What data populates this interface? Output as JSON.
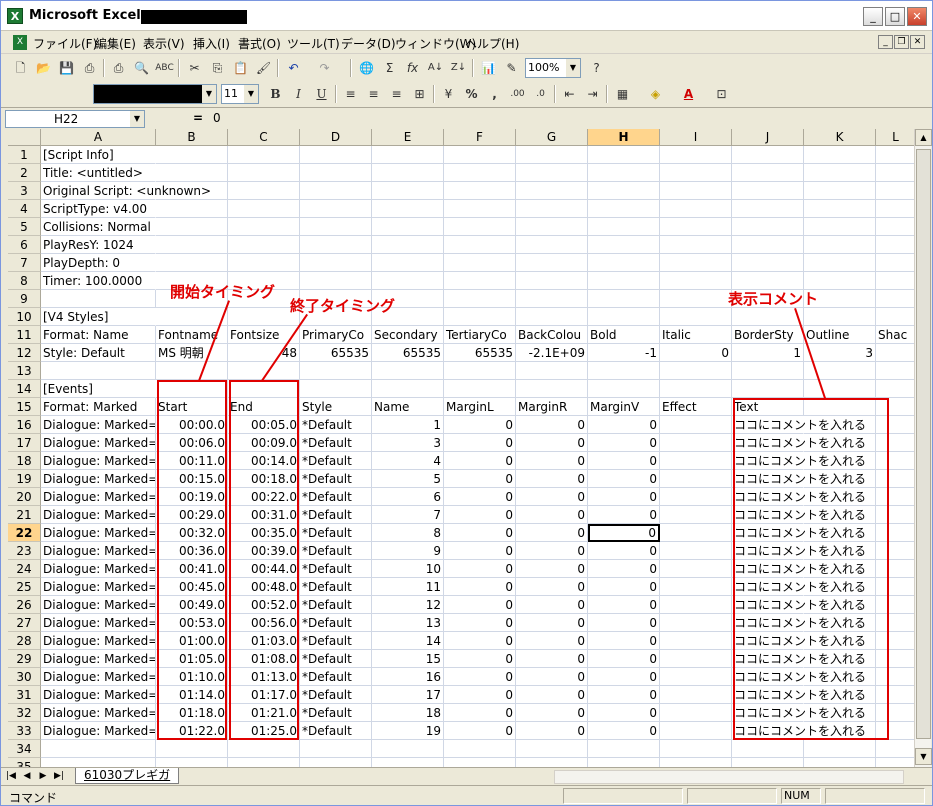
{
  "window": {
    "title": "Microsoft Excel -",
    "app_icon": "X"
  },
  "menu": {
    "doc_icon": "X",
    "items": [
      "ファイル(F)",
      "編集(E)",
      "表示(V)",
      "挿入(I)",
      "書式(O)",
      "ツール(T)",
      "データ(D)",
      "ウィンドウ(W)",
      "ヘルプ(H)"
    ]
  },
  "toolbar": {
    "zoom": "100%",
    "font_size": "11",
    "bold": "B",
    "italic": "I",
    "underline": "U",
    "percent": "%",
    "comma": ","
  },
  "formula": {
    "cell_ref": "H22",
    "eq": "=",
    "value": "0"
  },
  "columns": [
    "A",
    "B",
    "C",
    "D",
    "E",
    "F",
    "G",
    "H",
    "I",
    "J",
    "K",
    "L"
  ],
  "rows": [
    {
      "n": "1",
      "cells": [
        "[Script Info]"
      ]
    },
    {
      "n": "2",
      "cells": [
        "Title: <untitled>"
      ]
    },
    {
      "n": "3",
      "cells": [
        "Original Script: <unknown>"
      ]
    },
    {
      "n": "4",
      "cells": [
        "ScriptType: v4.00"
      ]
    },
    {
      "n": "5",
      "cells": [
        "Collisions: Normal"
      ]
    },
    {
      "n": "6",
      "cells": [
        "PlayResY: 1024"
      ]
    },
    {
      "n": "7",
      "cells": [
        "PlayDepth: 0"
      ]
    },
    {
      "n": "8",
      "cells": [
        "Timer: 100.0000"
      ]
    },
    {
      "n": "9",
      "cells": []
    },
    {
      "n": "10",
      "cells": [
        "[V4 Styles]"
      ]
    },
    {
      "n": "11",
      "cells": [
        "Format: Name",
        "Fontname",
        "Fontsize",
        "PrimaryCo",
        "Secondary",
        "TertiaryCo",
        "BackColou",
        "Bold",
        "Italic",
        "BorderSty",
        "Outline",
        "Shac"
      ]
    },
    {
      "n": "12",
      "cells": [
        "Style: Default",
        "MS 明朝",
        "48",
        "65535",
        "65535",
        "65535",
        "-2.1E+09",
        "-1",
        "0",
        "1",
        "3",
        ""
      ]
    },
    {
      "n": "13",
      "cells": []
    },
    {
      "n": "14",
      "cells": [
        "[Events]"
      ]
    },
    {
      "n": "15",
      "cells": [
        "Format: Marked",
        "Start",
        "End",
        "Style",
        "Name",
        "MarginL",
        "MarginR",
        "MarginV",
        "Effect",
        "Text"
      ]
    },
    {
      "n": "16",
      "cells": [
        "Dialogue: Marked=",
        "00:00.0",
        "00:05.0",
        "*Default",
        "1",
        "0",
        "0",
        "0",
        "",
        "ココにコメントを入れる"
      ]
    },
    {
      "n": "17",
      "cells": [
        "Dialogue: Marked=",
        "00:06.0",
        "00:09.0",
        "*Default",
        "3",
        "0",
        "0",
        "0",
        "",
        "ココにコメントを入れる"
      ]
    },
    {
      "n": "18",
      "cells": [
        "Dialogue: Marked=",
        "00:11.0",
        "00:14.0",
        "*Default",
        "4",
        "0",
        "0",
        "0",
        "",
        "ココにコメントを入れる"
      ]
    },
    {
      "n": "19",
      "cells": [
        "Dialogue: Marked=",
        "00:15.0",
        "00:18.0",
        "*Default",
        "5",
        "0",
        "0",
        "0",
        "",
        "ココにコメントを入れる"
      ]
    },
    {
      "n": "20",
      "cells": [
        "Dialogue: Marked=",
        "00:19.0",
        "00:22.0",
        "*Default",
        "6",
        "0",
        "0",
        "0",
        "",
        "ココにコメントを入れる"
      ]
    },
    {
      "n": "21",
      "cells": [
        "Dialogue: Marked=",
        "00:29.0",
        "00:31.0",
        "*Default",
        "7",
        "0",
        "0",
        "0",
        "",
        "ココにコメントを入れる"
      ]
    },
    {
      "n": "22",
      "cells": [
        "Dialogue: Marked=",
        "00:32.0",
        "00:35.0",
        "*Default",
        "8",
        "0",
        "0",
        "0",
        "",
        "ココにコメントを入れる"
      ]
    },
    {
      "n": "23",
      "cells": [
        "Dialogue: Marked=",
        "00:36.0",
        "00:39.0",
        "*Default",
        "9",
        "0",
        "0",
        "0",
        "",
        "ココにコメントを入れる"
      ]
    },
    {
      "n": "24",
      "cells": [
        "Dialogue: Marked=",
        "00:41.0",
        "00:44.0",
        "*Default",
        "10",
        "0",
        "0",
        "0",
        "",
        "ココにコメントを入れる"
      ]
    },
    {
      "n": "25",
      "cells": [
        "Dialogue: Marked=",
        "00:45.0",
        "00:48.0",
        "*Default",
        "11",
        "0",
        "0",
        "0",
        "",
        "ココにコメントを入れる"
      ]
    },
    {
      "n": "26",
      "cells": [
        "Dialogue: Marked=",
        "00:49.0",
        "00:52.0",
        "*Default",
        "12",
        "0",
        "0",
        "0",
        "",
        "ココにコメントを入れる"
      ]
    },
    {
      "n": "27",
      "cells": [
        "Dialogue: Marked=",
        "00:53.0",
        "00:56.0",
        "*Default",
        "13",
        "0",
        "0",
        "0",
        "",
        "ココにコメントを入れる"
      ]
    },
    {
      "n": "28",
      "cells": [
        "Dialogue: Marked=",
        "01:00.0",
        "01:03.0",
        "*Default",
        "14",
        "0",
        "0",
        "0",
        "",
        "ココにコメントを入れる"
      ]
    },
    {
      "n": "29",
      "cells": [
        "Dialogue: Marked=",
        "01:05.0",
        "01:08.0",
        "*Default",
        "15",
        "0",
        "0",
        "0",
        "",
        "ココにコメントを入れる"
      ]
    },
    {
      "n": "30",
      "cells": [
        "Dialogue: Marked=",
        "01:10.0",
        "01:13.0",
        "*Default",
        "16",
        "0",
        "0",
        "0",
        "",
        "ココにコメントを入れる"
      ]
    },
    {
      "n": "31",
      "cells": [
        "Dialogue: Marked=",
        "01:14.0",
        "01:17.0",
        "*Default",
        "17",
        "0",
        "0",
        "0",
        "",
        "ココにコメントを入れる"
      ]
    },
    {
      "n": "32",
      "cells": [
        "Dialogue: Marked=",
        "01:18.0",
        "01:21.0",
        "*Default",
        "18",
        "0",
        "0",
        "0",
        "",
        "ココにコメントを入れる"
      ]
    },
    {
      "n": "33",
      "cells": [
        "Dialogue: Marked=",
        "01:22.0",
        "01:25.0",
        "*Default",
        "19",
        "0",
        "0",
        "0",
        "",
        "ココにコメントを入れる"
      ]
    },
    {
      "n": "34",
      "cells": []
    },
    {
      "n": "35",
      "cells": []
    }
  ],
  "selected": {
    "row": "22",
    "col": "H"
  },
  "annotations": {
    "start": "開始タイミング",
    "end": "終了タイミング",
    "text": "表示コメント"
  },
  "annotation_color": "#e00000",
  "sheet_tab": "61030プレギガ",
  "status": {
    "mode": "コマンド",
    "num": "NUM"
  }
}
